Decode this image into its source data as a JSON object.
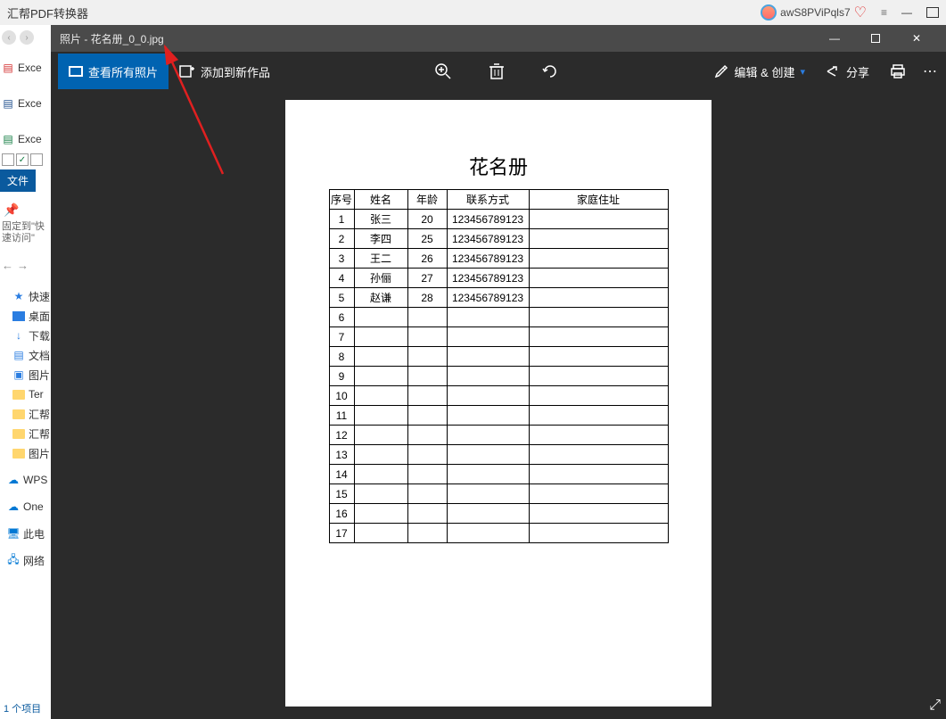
{
  "bg": {
    "title": "汇帮PDF转换器",
    "user": "awS8PViPqls7"
  },
  "sidebar": {
    "items": [
      "Exce",
      "Exce",
      "Exce"
    ],
    "fileTab": "文件",
    "pinText1": "固定到\"快",
    "pinText2": "速访问\"",
    "quick": "快速",
    "nav": [
      "桌面",
      "下载",
      "文档",
      "图片",
      "Ter",
      "汇帮",
      "汇帮",
      "图片",
      "WPS",
      "One",
      "此电",
      "网络"
    ],
    "status": "1 个项目"
  },
  "photos": {
    "title": "照片 - 花名册_0_0.jpg",
    "toolbar": {
      "viewAll": "查看所有照片",
      "addTo": "添加到新作品",
      "edit": "编辑 & 创建",
      "share": "分享"
    }
  },
  "chart_data": {
    "type": "table",
    "title": "花名册",
    "columns": [
      "序号",
      "姓名",
      "年龄",
      "联系方式",
      "家庭住址"
    ],
    "rows": [
      [
        "1",
        "张三",
        "20",
        "123456789123",
        ""
      ],
      [
        "2",
        "李四",
        "25",
        "123456789123",
        ""
      ],
      [
        "3",
        "王二",
        "26",
        "123456789123",
        ""
      ],
      [
        "4",
        "孙俪",
        "27",
        "123456789123",
        ""
      ],
      [
        "5",
        "赵谦",
        "28",
        "123456789123",
        ""
      ],
      [
        "6",
        "",
        "",
        "",
        ""
      ],
      [
        "7",
        "",
        "",
        "",
        ""
      ],
      [
        "8",
        "",
        "",
        "",
        ""
      ],
      [
        "9",
        "",
        "",
        "",
        ""
      ],
      [
        "10",
        "",
        "",
        "",
        ""
      ],
      [
        "11",
        "",
        "",
        "",
        ""
      ],
      [
        "12",
        "",
        "",
        "",
        ""
      ],
      [
        "13",
        "",
        "",
        "",
        ""
      ],
      [
        "14",
        "",
        "",
        "",
        ""
      ],
      [
        "15",
        "",
        "",
        "",
        ""
      ],
      [
        "16",
        "",
        "",
        "",
        ""
      ],
      [
        "17",
        "",
        "",
        "",
        ""
      ]
    ]
  }
}
